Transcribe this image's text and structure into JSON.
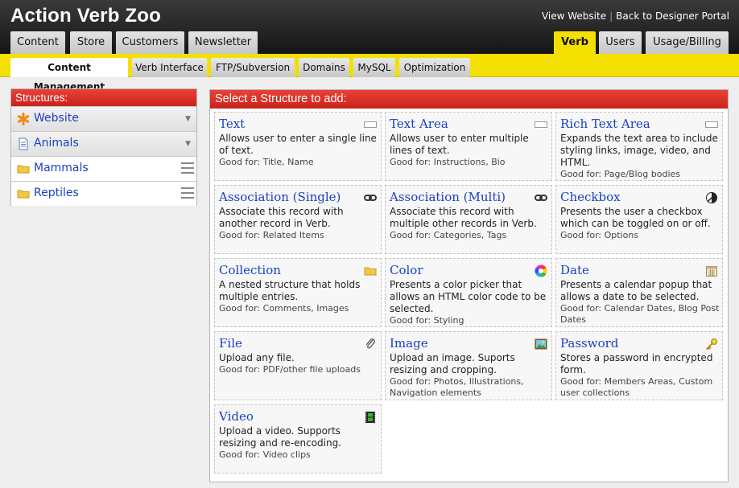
{
  "app": {
    "title": "Action Verb Zoo",
    "view_website": "View Website",
    "back_portal": "Back to Designer Portal"
  },
  "main_tabs": [
    "Content",
    "Store",
    "Customers",
    "Newsletter"
  ],
  "right_tabs": [
    "Verb",
    "Users",
    "Usage/Billing"
  ],
  "sub_tabs": [
    "Content Management",
    "Verb Interface",
    "FTP/Subversion",
    "Domains",
    "MySQL",
    "Optimization"
  ],
  "structures": {
    "heading": "Structures:",
    "items": [
      "Website",
      "Animals",
      "Mammals",
      "Reptiles"
    ]
  },
  "select": {
    "heading": "Select a Structure to add:",
    "cards": [
      {
        "title": "Text",
        "desc": "Allows user to enter a single line of text.",
        "good": "Good for: Title, Name",
        "icon": "text-field-icon"
      },
      {
        "title": "Text Area",
        "desc": "Allows user to enter multiple lines of text.",
        "good": "Good for: Instructions, Bio",
        "icon": "text-area-icon"
      },
      {
        "title": "Rich Text Area",
        "desc": "Expands the text area to include styling links, image, video, and HTML.",
        "good": "Good for: Page/Blog bodies",
        "icon": "rich-text-icon"
      },
      {
        "title": "Association (Single)",
        "desc": "Associate this record with another record in Verb.",
        "good": "Good for: Related Items",
        "icon": "link-icon"
      },
      {
        "title": "Association (Multi)",
        "desc": "Associate this record with multiple other records in Verb.",
        "good": "Good for: Categories, Tags",
        "icon": "link-icon"
      },
      {
        "title": "Checkbox",
        "desc": "Presents the user a checkbox which can be toggled on or off.",
        "good": "Good for: Options",
        "icon": "toggle-icon"
      },
      {
        "title": "Collection",
        "desc": "A nested structure that holds multiple entries.",
        "good": "Good for: Comments, Images",
        "icon": "folder-icon"
      },
      {
        "title": "Color",
        "desc": "Presents a color picker that allows an HTML color code to be selected.",
        "good": "Good for: Styling",
        "icon": "color-wheel-icon"
      },
      {
        "title": "Date",
        "desc": "Presents a calendar popup that allows a date to be selected.",
        "good": "Good for: Calendar Dates, Blog Post Dates",
        "icon": "calendar-icon"
      },
      {
        "title": "File",
        "desc": "Upload any file.",
        "good": "Good for: PDF/other file uploads",
        "icon": "paperclip-icon"
      },
      {
        "title": "Image",
        "desc": "Upload an image. Suports resizing and cropping.",
        "good": "Good for: Photos, Illustrations, Navigation elements",
        "icon": "image-icon"
      },
      {
        "title": "Password",
        "desc": "Stores a password in encrypted form.",
        "good": "Good for: Members Areas, Custom user collections",
        "icon": "key-icon"
      },
      {
        "title": "Video",
        "desc": "Upload a video. Supports resizing and re-encoding.",
        "good": "Good for: Video clips",
        "icon": "film-icon"
      }
    ]
  },
  "colors": {
    "header_dark": "#1a1a1a",
    "accent_yellow": "#f4e000",
    "panel_red": "#d92b20",
    "link_blue": "#1a40c0"
  }
}
